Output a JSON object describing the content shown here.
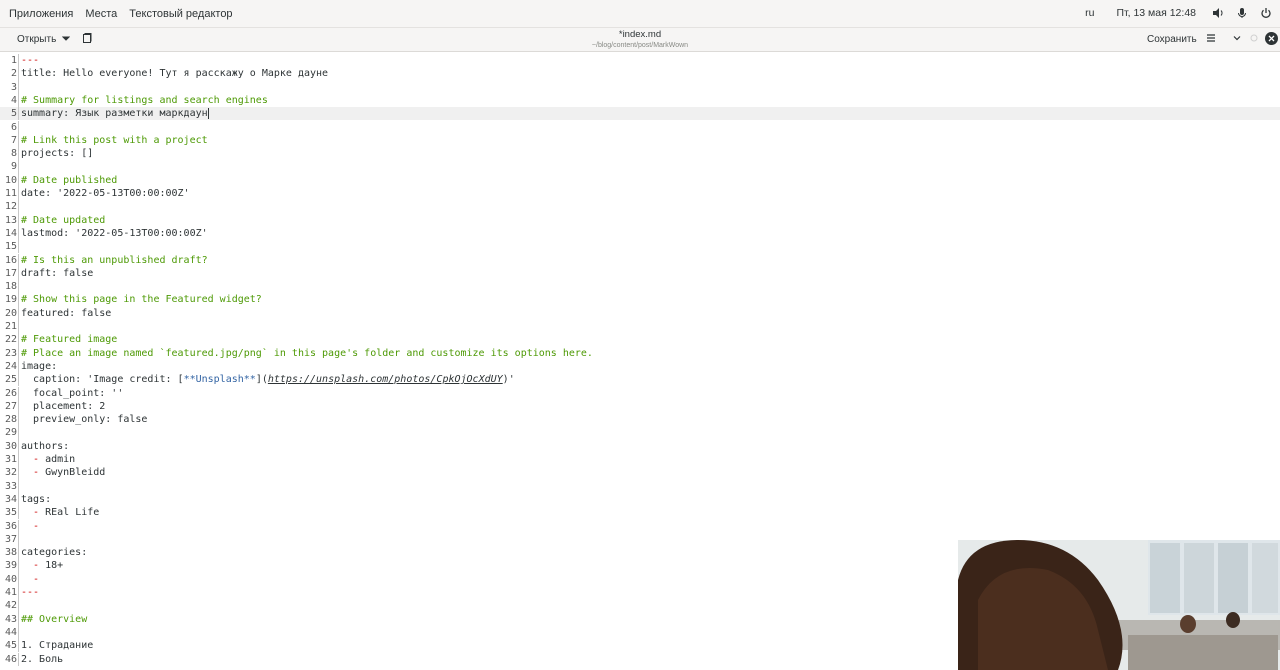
{
  "topbar": {
    "menu": [
      "Приложения",
      "Места",
      "Текстовый редактор"
    ],
    "lang": "ru",
    "datetime": "Пт, 13 мая  12:48"
  },
  "headerbar": {
    "open_label": "Открыть",
    "title": "*index.md",
    "path": "~/blog/content/post/MarkWown",
    "save_label": "Сохранить"
  },
  "editor": {
    "lines": [
      {
        "n": "1",
        "parts": [
          {
            "t": "---",
            "c": "c-dash"
          }
        ]
      },
      {
        "n": "2",
        "parts": [
          {
            "t": "title: Hello everyone! Тут я расскажу о Марке дауне",
            "c": ""
          }
        ]
      },
      {
        "n": "3",
        "parts": []
      },
      {
        "n": "4",
        "parts": [
          {
            "t": "# Summary for listings and search engines",
            "c": "c-comment"
          }
        ]
      },
      {
        "n": "5",
        "parts": [
          {
            "t": "summary: Язык разметки маркдаун",
            "c": ""
          }
        ],
        "current": true
      },
      {
        "n": "6",
        "parts": []
      },
      {
        "n": "7",
        "parts": [
          {
            "t": "# Link this post with a project",
            "c": "c-comment"
          }
        ]
      },
      {
        "n": "8",
        "parts": [
          {
            "t": "projects: []",
            "c": ""
          }
        ]
      },
      {
        "n": "9",
        "parts": []
      },
      {
        "n": "10",
        "parts": [
          {
            "t": "# Date published",
            "c": "c-comment"
          }
        ]
      },
      {
        "n": "11",
        "parts": [
          {
            "t": "date: '2022-05-13T00:00:00Z'",
            "c": ""
          }
        ]
      },
      {
        "n": "12",
        "parts": []
      },
      {
        "n": "13",
        "parts": [
          {
            "t": "# Date updated",
            "c": "c-comment"
          }
        ]
      },
      {
        "n": "14",
        "parts": [
          {
            "t": "lastmod: '2022-05-13T00:00:00Z'",
            "c": ""
          }
        ]
      },
      {
        "n": "15",
        "parts": []
      },
      {
        "n": "16",
        "parts": [
          {
            "t": "# Is this an unpublished draft?",
            "c": "c-comment"
          }
        ]
      },
      {
        "n": "17",
        "parts": [
          {
            "t": "draft: false",
            "c": ""
          }
        ]
      },
      {
        "n": "18",
        "parts": []
      },
      {
        "n": "19",
        "parts": [
          {
            "t": "# Show this page in the Featured widget?",
            "c": "c-comment"
          }
        ]
      },
      {
        "n": "20",
        "parts": [
          {
            "t": "featured: false",
            "c": ""
          }
        ]
      },
      {
        "n": "21",
        "parts": []
      },
      {
        "n": "22",
        "parts": [
          {
            "t": "# Featured image",
            "c": "c-comment"
          }
        ]
      },
      {
        "n": "23",
        "parts": [
          {
            "t": "# Place an image named `featured.jpg/png` in this page's folder and customize its options here.",
            "c": "c-comment"
          }
        ]
      },
      {
        "n": "24",
        "parts": [
          {
            "t": "image:",
            "c": ""
          }
        ]
      },
      {
        "n": "25",
        "parts": [
          {
            "t": "  caption: 'Image credit: [",
            "c": ""
          },
          {
            "t": "**Unsplash**",
            "c": "c-blue"
          },
          {
            "t": "](",
            "c": ""
          },
          {
            "t": "https://unsplash.com/photos/CpkOjOcXdUY",
            "c": "c-link"
          },
          {
            "t": ")'",
            "c": ""
          }
        ]
      },
      {
        "n": "26",
        "parts": [
          {
            "t": "  focal_point: ''",
            "c": ""
          }
        ]
      },
      {
        "n": "27",
        "parts": [
          {
            "t": "  placement: 2",
            "c": ""
          }
        ]
      },
      {
        "n": "28",
        "parts": [
          {
            "t": "  preview_only: false",
            "c": ""
          }
        ]
      },
      {
        "n": "29",
        "parts": []
      },
      {
        "n": "30",
        "parts": [
          {
            "t": "authors:",
            "c": ""
          }
        ]
      },
      {
        "n": "31",
        "parts": [
          {
            "t": "  ",
            "c": ""
          },
          {
            "t": "-",
            "c": "c-dash"
          },
          {
            "t": " admin",
            "c": ""
          }
        ]
      },
      {
        "n": "32",
        "parts": [
          {
            "t": "  ",
            "c": ""
          },
          {
            "t": "-",
            "c": "c-dash"
          },
          {
            "t": " GwynBleidd",
            "c": ""
          }
        ]
      },
      {
        "n": "33",
        "parts": []
      },
      {
        "n": "34",
        "parts": [
          {
            "t": "tags:",
            "c": ""
          }
        ]
      },
      {
        "n": "35",
        "parts": [
          {
            "t": "  ",
            "c": ""
          },
          {
            "t": "-",
            "c": "c-dash"
          },
          {
            "t": " REal Life",
            "c": ""
          }
        ]
      },
      {
        "n": "36",
        "parts": [
          {
            "t": "  ",
            "c": ""
          },
          {
            "t": "-",
            "c": "c-dash"
          }
        ]
      },
      {
        "n": "37",
        "parts": []
      },
      {
        "n": "38",
        "parts": [
          {
            "t": "categories:",
            "c": ""
          }
        ]
      },
      {
        "n": "39",
        "parts": [
          {
            "t": "  ",
            "c": ""
          },
          {
            "t": "-",
            "c": "c-dash"
          },
          {
            "t": " 18+",
            "c": ""
          }
        ]
      },
      {
        "n": "40",
        "parts": [
          {
            "t": "  ",
            "c": ""
          },
          {
            "t": "-",
            "c": "c-dash"
          }
        ]
      },
      {
        "n": "41",
        "parts": [
          {
            "t": "---",
            "c": "c-dash"
          }
        ]
      },
      {
        "n": "42",
        "parts": []
      },
      {
        "n": "43",
        "parts": [
          {
            "t": "## Overview",
            "c": "c-head"
          }
        ]
      },
      {
        "n": "44",
        "parts": []
      },
      {
        "n": "45",
        "parts": [
          {
            "t": "1. Страдание",
            "c": ""
          }
        ]
      },
      {
        "n": "46",
        "parts": [
          {
            "t": "2. Боль",
            "c": ""
          }
        ]
      }
    ]
  },
  "colors": {
    "comment": "#4e9a06",
    "dash": "#cc0000",
    "link": "#3465a4",
    "topbar_bg": "#f6f5f4"
  },
  "icons": [
    "arrow-down-icon",
    "new-document-icon",
    "hamburger-menu-icon",
    "chevron-down-icon",
    "close-icon",
    "volume-icon",
    "mic-icon",
    "power-icon"
  ]
}
